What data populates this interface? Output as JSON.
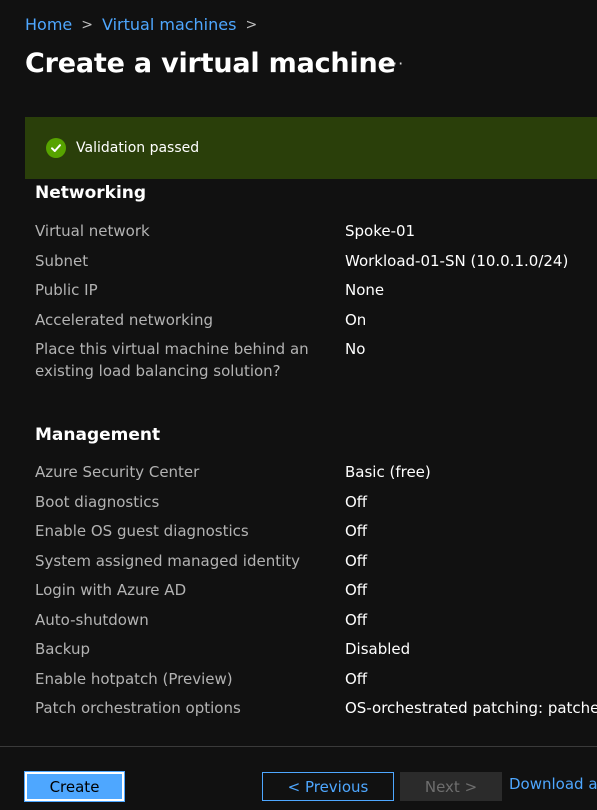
{
  "breadcrumb": {
    "home": "Home",
    "virtual_machines": "Virtual machines",
    "separator": ">"
  },
  "header": {
    "title": "Create a virtual machine",
    "more": "···"
  },
  "banner": {
    "text": "Validation passed",
    "color": "#2a3f0a",
    "icon": "check-circle-icon",
    "icon_color": "#57a300"
  },
  "networking": {
    "title": "Networking",
    "rows": [
      {
        "label": "Virtual network",
        "value": "Spoke-01"
      },
      {
        "label": "Subnet",
        "value": "Workload-01-SN (10.0.1.0/24)"
      },
      {
        "label": "Public IP",
        "value": "None"
      },
      {
        "label": "Accelerated networking",
        "value": "On"
      },
      {
        "label": "Place this virtual machine behind an existing load balancing solution?",
        "value": "No"
      }
    ]
  },
  "management": {
    "title": "Management",
    "rows": [
      {
        "label": "Azure Security Center",
        "value": "Basic (free)"
      },
      {
        "label": "Boot diagnostics",
        "value": "Off"
      },
      {
        "label": "Enable OS guest diagnostics",
        "value": "Off"
      },
      {
        "label": "System assigned managed identity",
        "value": "Off"
      },
      {
        "label": "Login with Azure AD",
        "value": "Off"
      },
      {
        "label": "Auto-shutdown",
        "value": "Off"
      },
      {
        "label": "Backup",
        "value": "Disabled"
      },
      {
        "label": "Enable hotpatch (Preview)",
        "value": "Off"
      },
      {
        "label": "Patch orchestration options",
        "value": "OS-orchestrated patching: patches"
      }
    ]
  },
  "footer": {
    "create": "Create",
    "previous": "< Previous",
    "next": "Next >",
    "download": "Download a"
  },
  "colors": {
    "accent": "#4ea7ff",
    "background": "#111111"
  }
}
